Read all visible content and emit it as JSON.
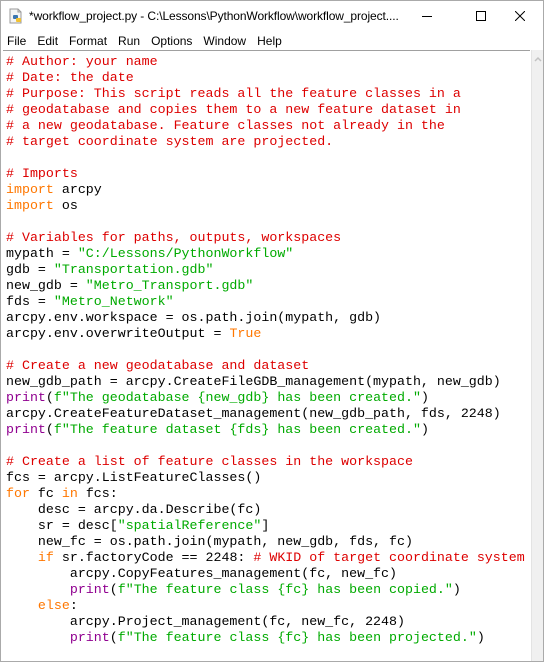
{
  "window": {
    "title": "*workflow_project.py - C:\\Lessons\\PythonWorkflow\\workflow_project....",
    "controls": {
      "minimize": "minimize-icon",
      "maximize": "maximize-icon",
      "close": "close-icon"
    },
    "app_icon": "python-file-icon"
  },
  "menubar": {
    "items": [
      "File",
      "Edit",
      "Format",
      "Run",
      "Options",
      "Window",
      "Help"
    ]
  },
  "syntax_colors": {
    "comment": "#dd0000",
    "keyword": "#ff7700",
    "string": "#00aa00",
    "builtin": "#900090",
    "plain": "#000000"
  },
  "editor": {
    "lines": [
      [
        {
          "t": "comment",
          "s": "# Author: your name"
        }
      ],
      [
        {
          "t": "comment",
          "s": "# Date: the date"
        }
      ],
      [
        {
          "t": "comment",
          "s": "# Purpose: This script reads all the feature classes in a"
        }
      ],
      [
        {
          "t": "comment",
          "s": "# geodatabase and copies them to a new feature dataset in"
        }
      ],
      [
        {
          "t": "comment",
          "s": "# a new geodatabase. Feature classes not already in the"
        }
      ],
      [
        {
          "t": "comment",
          "s": "# target coordinate system are projected."
        }
      ],
      [],
      [
        {
          "t": "comment",
          "s": "# Imports"
        }
      ],
      [
        {
          "t": "keyword",
          "s": "import"
        },
        {
          "t": "plain",
          "s": " arcpy"
        }
      ],
      [
        {
          "t": "keyword",
          "s": "import"
        },
        {
          "t": "plain",
          "s": " os"
        }
      ],
      [],
      [
        {
          "t": "comment",
          "s": "# Variables for paths, outputs, workspaces"
        }
      ],
      [
        {
          "t": "plain",
          "s": "mypath = "
        },
        {
          "t": "string",
          "s": "\"C:/Lessons/PythonWorkflow\""
        }
      ],
      [
        {
          "t": "plain",
          "s": "gdb = "
        },
        {
          "t": "string",
          "s": "\"Transportation.gdb\""
        }
      ],
      [
        {
          "t": "plain",
          "s": "new_gdb = "
        },
        {
          "t": "string",
          "s": "\"Metro_Transport.gdb\""
        }
      ],
      [
        {
          "t": "plain",
          "s": "fds = "
        },
        {
          "t": "string",
          "s": "\"Metro_Network\""
        }
      ],
      [
        {
          "t": "plain",
          "s": "arcpy.env.workspace = os.path.join(mypath, gdb)"
        }
      ],
      [
        {
          "t": "plain",
          "s": "arcpy.env.overwriteOutput = "
        },
        {
          "t": "keyword",
          "s": "True"
        }
      ],
      [],
      [
        {
          "t": "comment",
          "s": "# Create a new geodatabase and dataset"
        }
      ],
      [
        {
          "t": "plain",
          "s": "new_gdb_path = arcpy.CreateFileGDB_management(mypath, new_gdb)"
        }
      ],
      [
        {
          "t": "builtin",
          "s": "print"
        },
        {
          "t": "plain",
          "s": "("
        },
        {
          "t": "string",
          "s": "f\"The geodatabase {new_gdb} has been created.\""
        },
        {
          "t": "plain",
          "s": ")"
        }
      ],
      [
        {
          "t": "plain",
          "s": "arcpy.CreateFeatureDataset_management(new_gdb_path, fds, 2248)"
        }
      ],
      [
        {
          "t": "builtin",
          "s": "print"
        },
        {
          "t": "plain",
          "s": "("
        },
        {
          "t": "string",
          "s": "f\"The feature dataset {fds} has been created.\""
        },
        {
          "t": "plain",
          "s": ")"
        }
      ],
      [],
      [
        {
          "t": "comment",
          "s": "# Create a list of feature classes in the workspace"
        }
      ],
      [
        {
          "t": "plain",
          "s": "fcs = arcpy.ListFeatureClasses()"
        }
      ],
      [
        {
          "t": "keyword",
          "s": "for"
        },
        {
          "t": "plain",
          "s": " fc "
        },
        {
          "t": "keyword",
          "s": "in"
        },
        {
          "t": "plain",
          "s": " fcs:"
        }
      ],
      [
        {
          "t": "plain",
          "s": "    desc = arcpy.da.Describe(fc)"
        }
      ],
      [
        {
          "t": "plain",
          "s": "    sr = desc["
        },
        {
          "t": "string",
          "s": "\"spatialReference\""
        },
        {
          "t": "plain",
          "s": "]"
        }
      ],
      [
        {
          "t": "plain",
          "s": "    new_fc = os.path.join(mypath, new_gdb, fds, fc)"
        }
      ],
      [
        {
          "t": "plain",
          "s": "    "
        },
        {
          "t": "keyword",
          "s": "if"
        },
        {
          "t": "plain",
          "s": " sr.factoryCode == 2248: "
        },
        {
          "t": "comment",
          "s": "# WKID of target coordinate system"
        }
      ],
      [
        {
          "t": "plain",
          "s": "        arcpy.CopyFeatures_management(fc, new_fc)"
        }
      ],
      [
        {
          "t": "plain",
          "s": "        "
        },
        {
          "t": "builtin",
          "s": "print"
        },
        {
          "t": "plain",
          "s": "("
        },
        {
          "t": "string",
          "s": "f\"The feature class {fc} has been copied.\""
        },
        {
          "t": "plain",
          "s": ")"
        }
      ],
      [
        {
          "t": "plain",
          "s": "    "
        },
        {
          "t": "keyword",
          "s": "else"
        },
        {
          "t": "plain",
          "s": ":"
        }
      ],
      [
        {
          "t": "plain",
          "s": "        arcpy.Project_management(fc, new_fc, 2248)"
        }
      ],
      [
        {
          "t": "plain",
          "s": "        "
        },
        {
          "t": "builtin",
          "s": "print"
        },
        {
          "t": "plain",
          "s": "("
        },
        {
          "t": "string",
          "s": "f\"The feature class {fc} has been projected.\""
        },
        {
          "t": "plain",
          "s": ")"
        }
      ]
    ]
  }
}
